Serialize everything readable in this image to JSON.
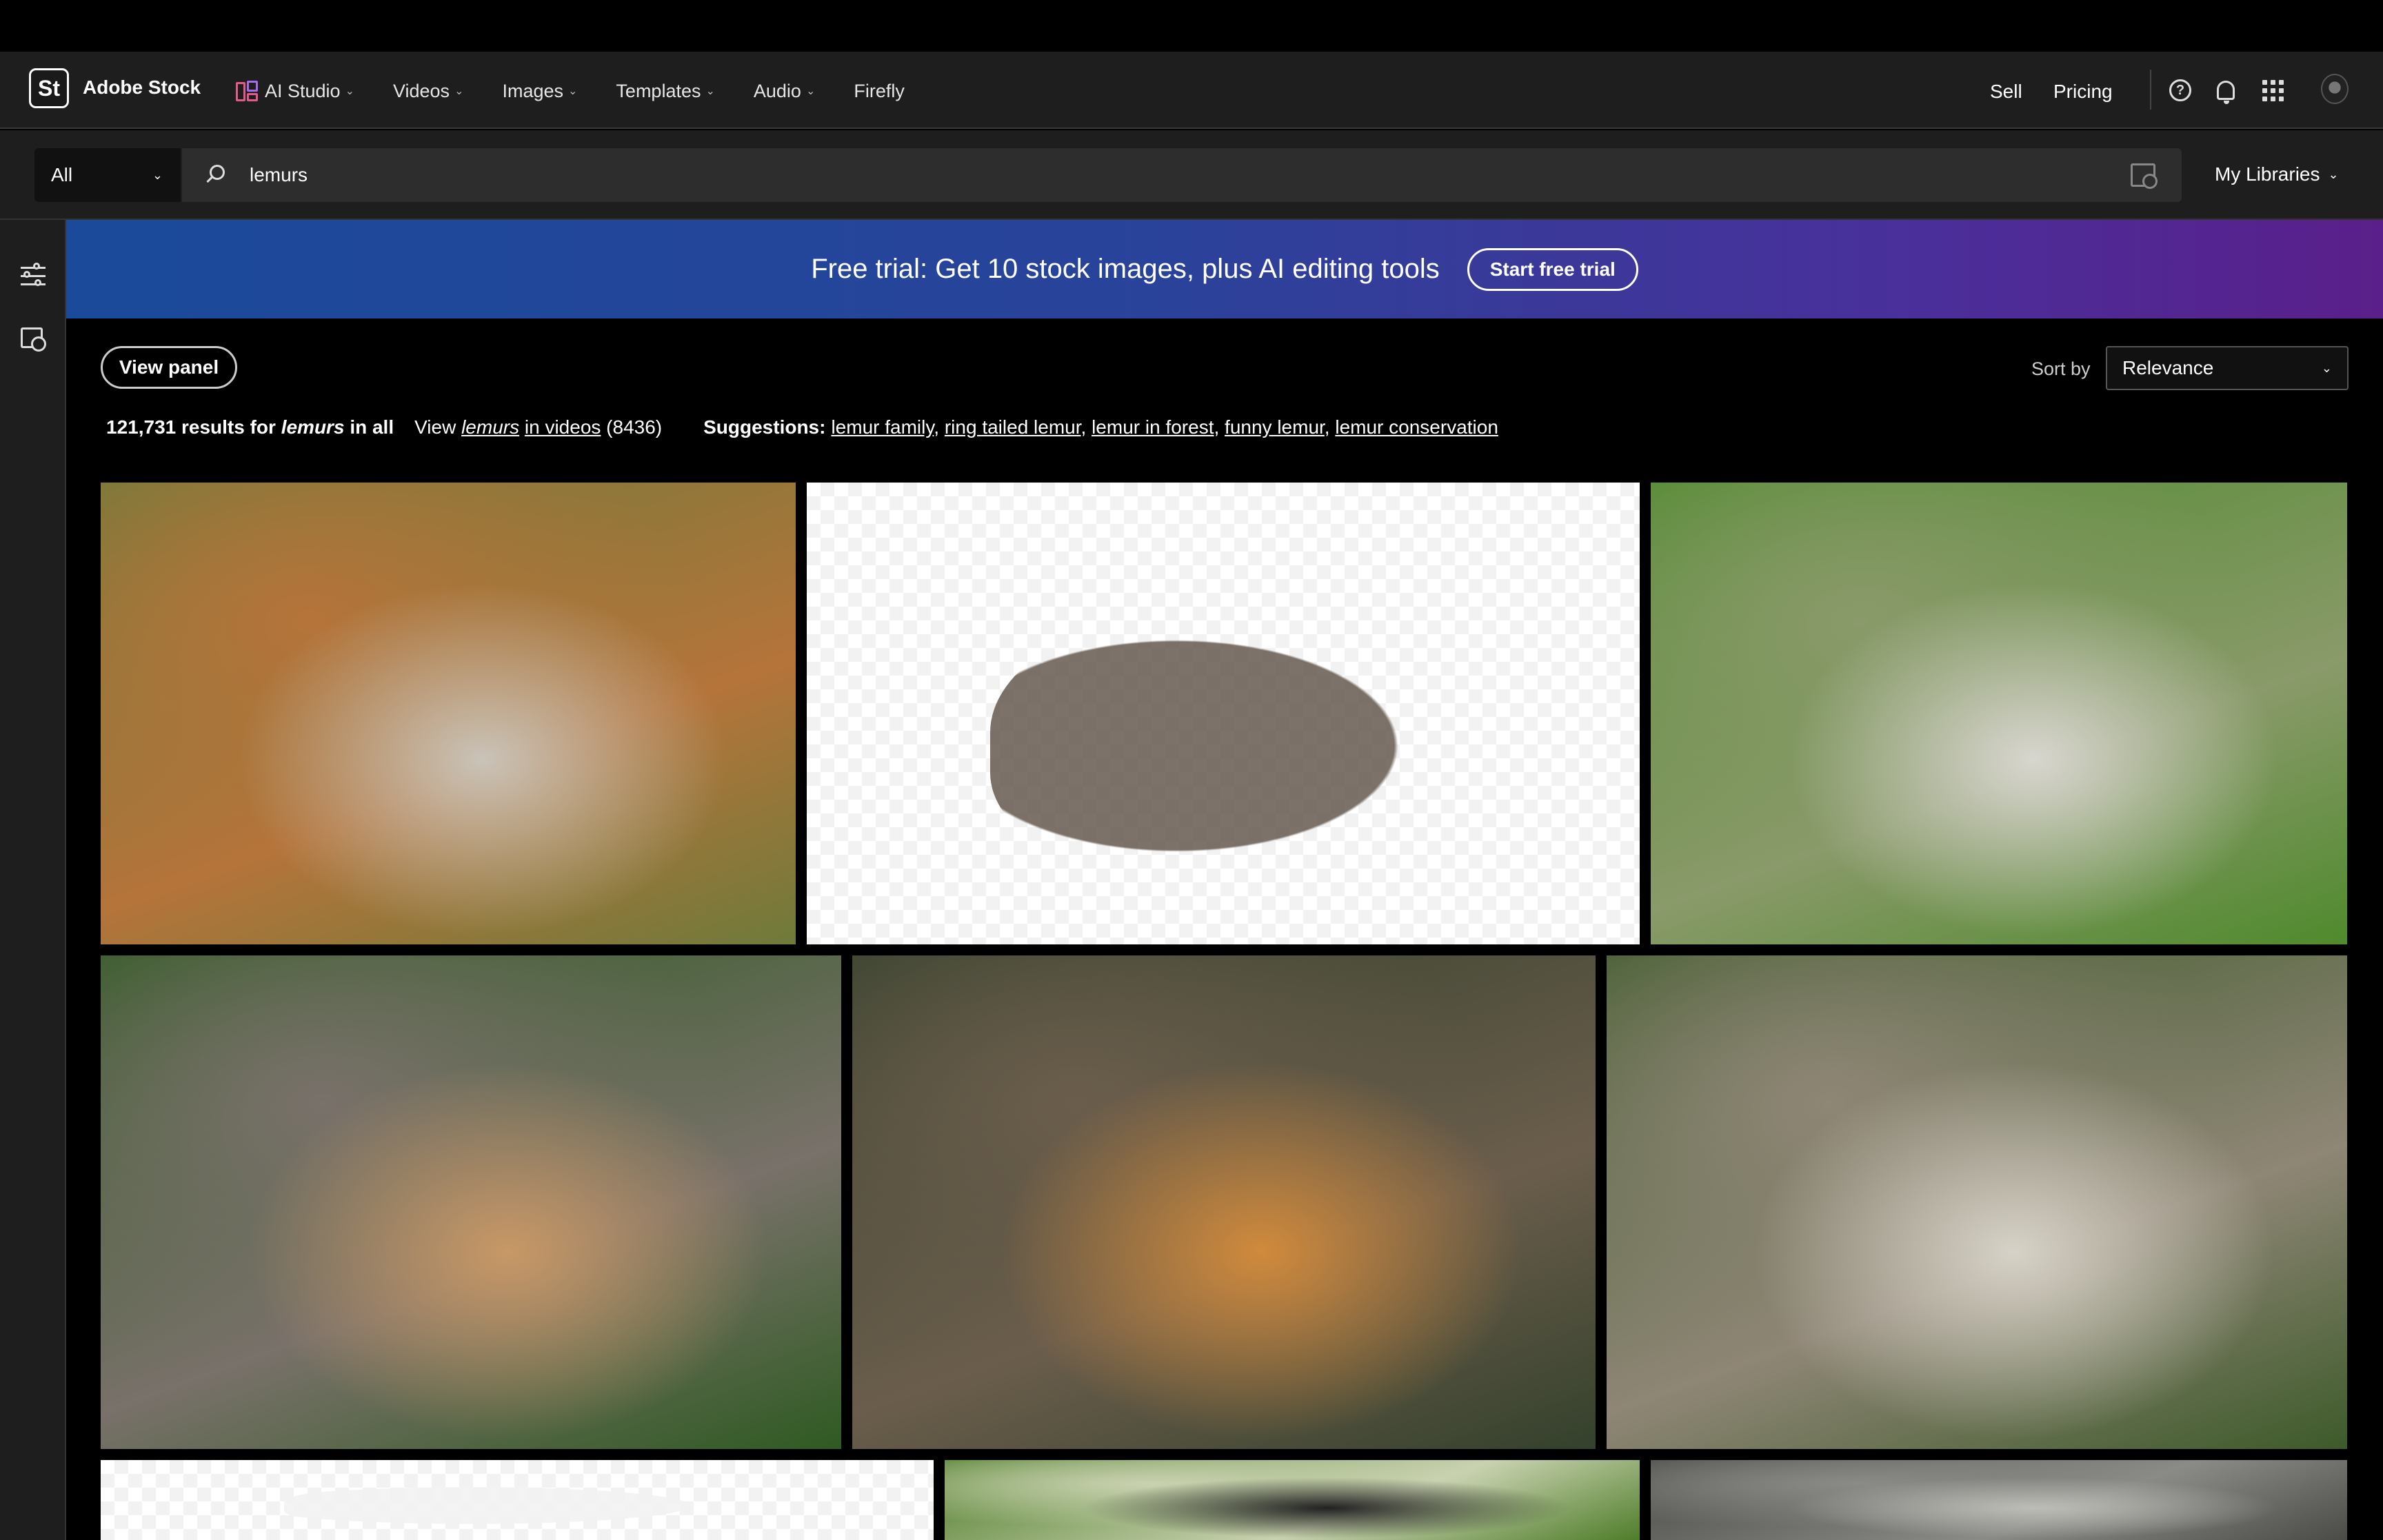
{
  "header": {
    "logo": "St",
    "brand": "Adobe Stock",
    "nav": [
      {
        "label": "AI Studio"
      },
      {
        "label": "Videos"
      },
      {
        "label": "Images"
      },
      {
        "label": "Templates"
      },
      {
        "label": "Audio"
      },
      {
        "label": "Firefly"
      }
    ],
    "sell": "Sell",
    "pricing": "Pricing",
    "help_glyph": "?"
  },
  "search": {
    "scope": "All",
    "query": "lemurs",
    "libraries": "My Libraries"
  },
  "banner": {
    "text": "Free trial: Get 10 stock images, plus AI editing tools",
    "button": "Start free trial"
  },
  "controls": {
    "view_panel": "View panel",
    "sort_label": "Sort by",
    "sort_value": "Relevance"
  },
  "results": {
    "count": "121,731 results for",
    "term": "lemurs",
    "in_all": "in all",
    "view": "View",
    "video_term": "lemurs",
    "in_videos": "in videos",
    "video_count": "(8436)",
    "suggestions_label": "Suggestions:",
    "suggestions": [
      "lemur family",
      "ring tailed lemur",
      "lemur in forest",
      "funny lemur",
      "lemur conservation"
    ]
  },
  "images": [
    {
      "name": "group-of-lemurs-on-fence",
      "colors": [
        "#6f7a3a",
        "#b5743a",
        "#c9c3b8"
      ]
    },
    {
      "name": "walking-lemur-transparent",
      "colors": [
        "#ffffff",
        "#6d6258",
        "#222222"
      ]
    },
    {
      "name": "lemur-family-close-up",
      "colors": [
        "#4f8a2d",
        "#8a9a6a",
        "#d8d6cf"
      ]
    },
    {
      "name": "lemur-on-log",
      "colors": [
        "#2f5a22",
        "#79716a",
        "#c89866"
      ]
    },
    {
      "name": "sifaka-on-tree",
      "colors": [
        "#34412c",
        "#6b5d4c",
        "#d08a3c"
      ]
    },
    {
      "name": "excited-lemurs-selfie",
      "colors": [
        "#3d5a2a",
        "#8f8676",
        "#d7d2c7"
      ]
    },
    {
      "name": "lemur-partial-transparent",
      "colors": [
        "#ffffff",
        "#f2f2f2",
        "#555555"
      ]
    },
    {
      "name": "lemur-tail-green",
      "colors": [
        "#4f7d2a",
        "#c9d2b0",
        "#222222"
      ]
    },
    {
      "name": "lemur-grey-partial",
      "colors": [
        "#4a4a46",
        "#8a8a86",
        "#bdbdb8"
      ]
    }
  ]
}
